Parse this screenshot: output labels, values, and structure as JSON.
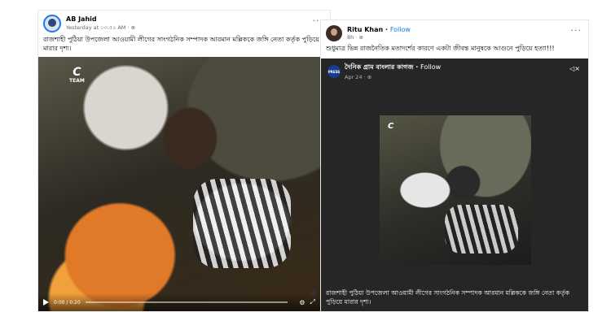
{
  "left_post": {
    "author": "AB Jahid",
    "meta": "Yesterday at ১৩:৫০ AM · ",
    "globe_icon": "globe-icon",
    "more": "···",
    "caption": "রাজশাহী পুঠিয়া উপজেলা আওয়ামী লীগের সাংগঠনিক সম্পাদক আরমান মল্লিককে জঙ্গি নেতা কর্তৃক পুড়িয়ে মারার দৃশ্য।",
    "video": {
      "logo_letter": "C",
      "logo_text": "TEAM",
      "time": "0:00 / 0:20"
    }
  },
  "right_post": {
    "author": "Ritu Khan",
    "separator": " · ",
    "follow_label": "Follow",
    "meta": "8h · ",
    "more": "···",
    "caption": "শুধুমাত্র ভিন্ন রাজনৈতিক মতাদর্শের কারণে একটা জীবন্ত মানুষকে আগুনে পুড়িয়ে হত্যা!!!",
    "shared": {
      "avatar_text": "PRESS",
      "page_name": "দৈনিক গ্রাম বাংলার কাগজ",
      "follow_label": "Follow",
      "meta": "Apr 24 · ",
      "video_logo": "C",
      "caption": "রাজশাহী পুঠিয়া উপজেলা আওয়ামী লীগের সাংগঠনিক সম্পাদক আরমান মল্লিককে জঙ্গি নেতা কর্তৃক পুড়িয়ে মারার দৃশ্য।"
    }
  }
}
